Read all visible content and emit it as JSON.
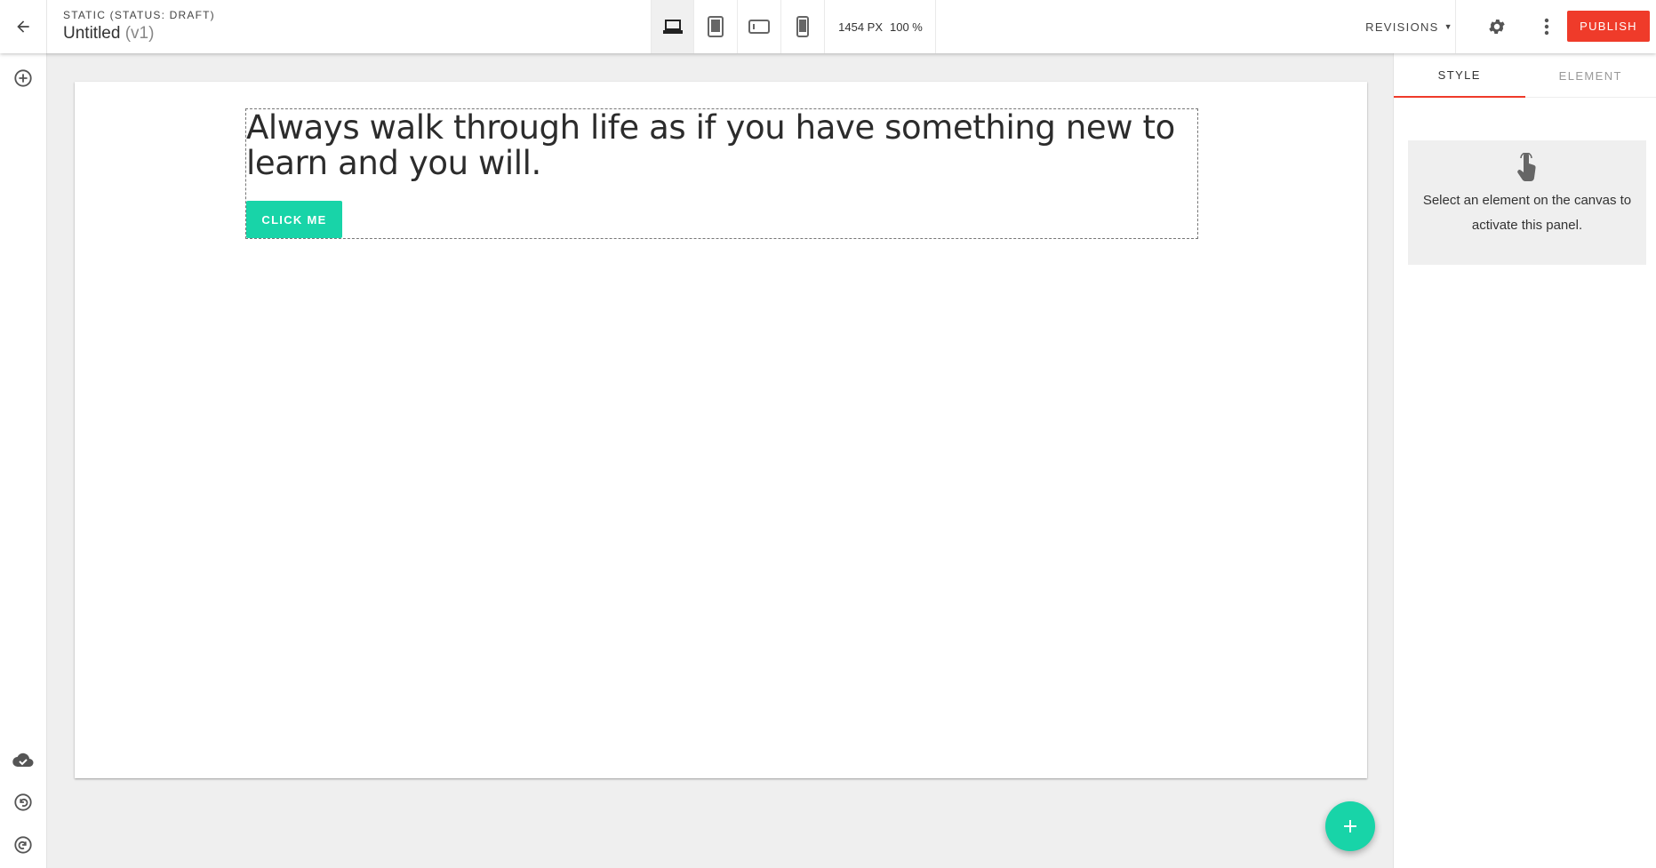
{
  "header": {
    "status_label": "STATIC (STATUS: DRAFT)",
    "title": "Untitled",
    "version": "(v1)",
    "width_readout": "1454 PX",
    "zoom_readout": "100 %",
    "revisions_label": "REVISIONS",
    "publish_label": "PUBLISH",
    "devices": [
      "laptop-icon",
      "tablet-icon",
      "tablet-landscape-icon",
      "phone-icon"
    ],
    "active_device": "laptop"
  },
  "canvas": {
    "headline": "Always walk through life as if you have something new to learn and you will.",
    "button_label": "CLICK ME"
  },
  "panel": {
    "tabs": [
      {
        "label": "STYLE",
        "active": true
      },
      {
        "label": "ELEMENT",
        "active": false
      }
    ],
    "empty_message": "Select an element on the canvas to activate this panel."
  },
  "colors": {
    "accent": "#18d4a8",
    "publish": "#ef3b2a",
    "tab_indicator": "#ef3b2a"
  }
}
